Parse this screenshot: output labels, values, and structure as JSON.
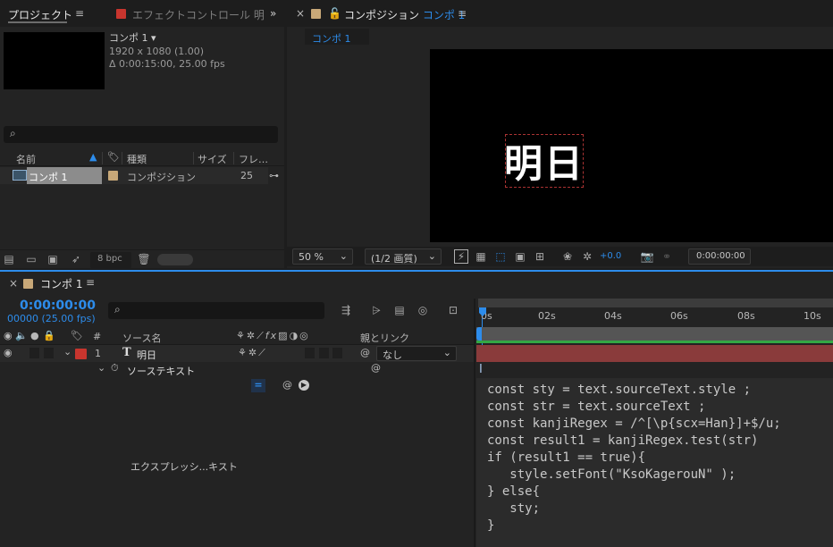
{
  "project_panel": {
    "tab_project": "プロジェクト",
    "tab_effects": "エフェクトコントロール 明",
    "comp_name": "コンポ 1",
    "comp_size": "1920 x 1080 (1.00)",
    "comp_duration": "Δ 0:00:15:00, 25.00 fps",
    "columns": {
      "name": "名前",
      "type": "種類",
      "size": "サイズ",
      "frame": "フレ…"
    },
    "item": {
      "name": "コンポ 1",
      "type": "コンポジション",
      "size": "25"
    },
    "bpc": "8 bpc"
  },
  "composition_panel": {
    "title": "コンポジション",
    "title_comp": "コンポ 1",
    "tab": "コンポ 1",
    "viewer_text": "明日",
    "zoom": "50 %",
    "resolution": "(1/2 画質)",
    "exposure": "+0.0",
    "timecode": "0:00:00:00"
  },
  "timeline": {
    "tab": "コンポ 1",
    "timecode": "0:00:00:00",
    "frame_info": "00000 (25.00 fps)",
    "headers": {
      "hash": "#",
      "source": "ソース名",
      "parent": "親とリンク"
    },
    "layer": {
      "index": "1",
      "name": "明日",
      "parent": "なし"
    },
    "property": "ソーステキスト",
    "expression_label": "エクスプレッシ...キスト",
    "ruler": [
      "0s",
      "02s",
      "04s",
      "06s",
      "08s",
      "10s"
    ],
    "code": [
      "const sty = text.sourceText.style ;",
      "const str = text.sourceText ;",
      "const kanjiRegex = /^[\\p{scx=Han}]+$/u;",
      "const result1 = kanjiRegex.test(str)",
      "if (result1 == true){",
      "   style.setFont(\"KsoKagerouN\" );",
      "} else{",
      "   sty;",
      "}"
    ]
  },
  "colors": {
    "accent": "#2d8ceb",
    "comp_swatch": "#c8a878",
    "layer_label": "#c8352e",
    "layer_bar": "#8a3b3b",
    "work_area": "#33a844"
  }
}
